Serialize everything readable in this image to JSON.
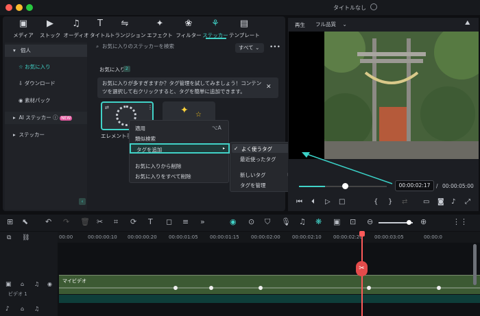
{
  "window": {
    "title": "タイトルなし"
  },
  "toolbar": [
    {
      "label": "メディア",
      "icon": "media-icon"
    },
    {
      "label": "ストック",
      "icon": "stock-icon"
    },
    {
      "label": "オーディオ",
      "icon": "music-icon"
    },
    {
      "label": "タイトル",
      "icon": "title-icon"
    },
    {
      "label": "トランジション",
      "icon": "transition-icon"
    },
    {
      "label": "エフェクト",
      "icon": "effect-icon"
    },
    {
      "label": "フィルター",
      "icon": "filter-icon"
    },
    {
      "label": "ステッカー",
      "icon": "sticker-icon",
      "active": true
    },
    {
      "label": "テンプレート",
      "icon": "template-icon"
    }
  ],
  "sidebar": {
    "personal": "個人",
    "favorites": "お気に入り",
    "downloads": "ダウンロード",
    "material_pack": "素材パック",
    "ai_sticker": "AI ステッカー",
    "new_badge": "NEW",
    "stickers": "ステッカー"
  },
  "search": {
    "placeholder": "お気に入りのステッカーを検索",
    "filter": "すべて"
  },
  "favorites": {
    "label": "お気に入り",
    "count": "2",
    "tip": "お気に入りが多すぎますか？タグ管理を試してみましょう！コンテンツを選択して右クリックすると、タグを簡単に追加できます。",
    "item_name": "エレメント手"
  },
  "context_menu": {
    "apply": "適用",
    "apply_shortcut": "⌥A",
    "similar": "類似検索",
    "add_tag": "タグを追加",
    "remove_fav": "お気に入りから削除",
    "remove_all_fav": "お気に入りをすべて削除"
  },
  "submenu": {
    "often": "よく使うタグ",
    "recent": "最近使ったタグ",
    "new_tag": "新しいタグ",
    "manage": "タグを管理"
  },
  "preview": {
    "play_label": "再生",
    "quality": "フル品質",
    "current_time": "00:00:02:17",
    "separator": "/",
    "total_time": "00:00:05:00",
    "progress": 0.3
  },
  "ruler": [
    "00:00",
    "00:00:00:10",
    "00:00:00:20",
    "00:00:01:05",
    "00:00:01:15",
    "00:00:02:00",
    "00:00:02:10",
    "00:00:02:20",
    "00:00:03:05",
    "00:00:0"
  ],
  "track": {
    "video_label": "ビデオ 1",
    "clip_name": "マイビデオ"
  }
}
